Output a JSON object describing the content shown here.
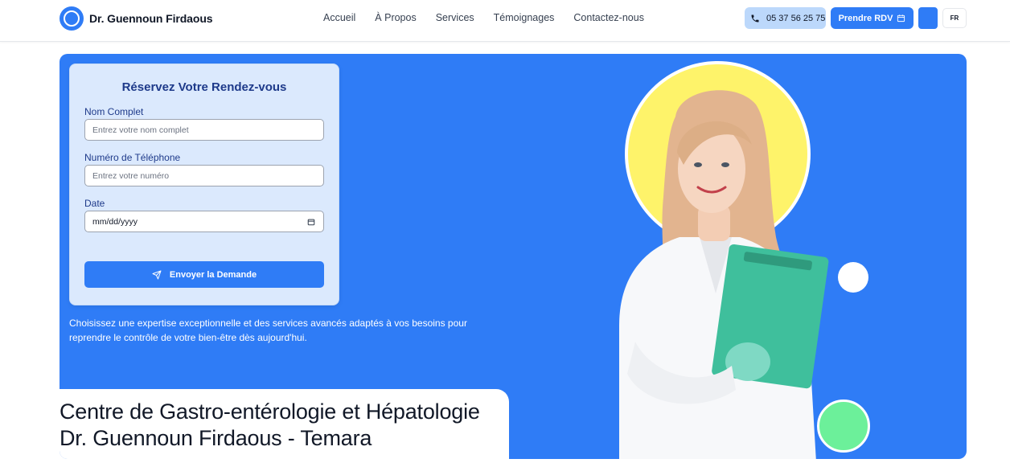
{
  "header": {
    "brand_name": "Dr. Guennoun Firdaous",
    "nav": [
      "Accueil",
      "À Propos",
      "Services",
      "Témoignages",
      "Contactez-nous"
    ],
    "phone": "05 37 56 25 75",
    "rdv_label": "Prendre RDV",
    "lang": "FR"
  },
  "form": {
    "title": "Réservez Votre Rendez-vous",
    "name_label": "Nom Complet",
    "name_placeholder": "Entrez votre nom complet",
    "phone_label": "Numéro de Téléphone",
    "phone_placeholder": "Entrez votre numéro",
    "date_label": "Date",
    "date_placeholder": "mm/dd/yyyy",
    "submit_label": "Envoyer la Demande"
  },
  "hero": {
    "text": "Choisissez une expertise exceptionnelle et des services avancés adaptés à vos besoins pour reprendre le contrôle de votre bien-être dès aujourd'hui.",
    "title_line1": "Centre de Gastro-entérologie et Hépatologie",
    "title_line2": "Dr. Guennoun Firdaous - Temara"
  },
  "colors": {
    "primary": "#2f7cf6",
    "accent_yellow": "#fef36a",
    "accent_green": "#6cf09a",
    "form_bg": "#dbe9fd"
  },
  "icons": [
    "phone-icon",
    "calendar-icon",
    "send-icon",
    "date-picker-icon"
  ]
}
